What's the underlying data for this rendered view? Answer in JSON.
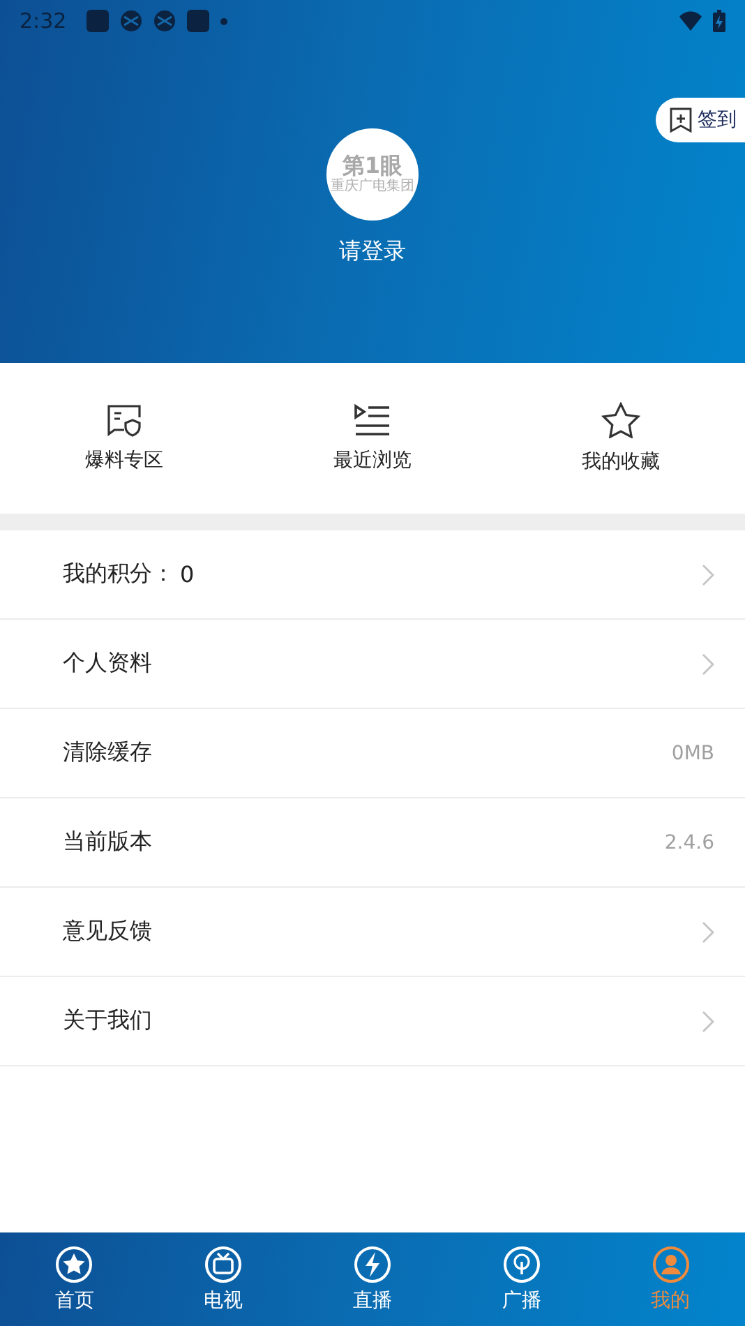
{
  "status_bar": {
    "time": "2:32"
  },
  "profile": {
    "logo_main": "第1眼",
    "logo_sub": "重庆广电集团",
    "login": "请登录",
    "checkin": "签到"
  },
  "shortcuts": [
    {
      "kind": "report",
      "label": "爆料专区"
    },
    {
      "kind": "history",
      "label": "最近浏览"
    },
    {
      "kind": "favorite",
      "label": "我的收藏"
    }
  ],
  "menu": [
    {
      "label": "我的积分：",
      "value": "0",
      "kind": "arrow"
    },
    {
      "label": "个人资料",
      "kind": "arrow"
    },
    {
      "label": "清除缓存",
      "value": "0MB",
      "kind": "info"
    },
    {
      "label": "当前版本",
      "value": "2.4.6",
      "kind": "info"
    },
    {
      "label": "意见反馈",
      "kind": "arrow"
    },
    {
      "label": "关于我们",
      "kind": "arrow"
    }
  ],
  "tabs": [
    {
      "kind": "home",
      "label": "首页",
      "selected": false
    },
    {
      "kind": "tv",
      "label": "电视",
      "selected": false
    },
    {
      "kind": "live",
      "label": "直播",
      "selected": false
    },
    {
      "kind": "radio",
      "label": "广播",
      "selected": false
    },
    {
      "kind": "me",
      "label": "我的",
      "selected": true
    }
  ]
}
